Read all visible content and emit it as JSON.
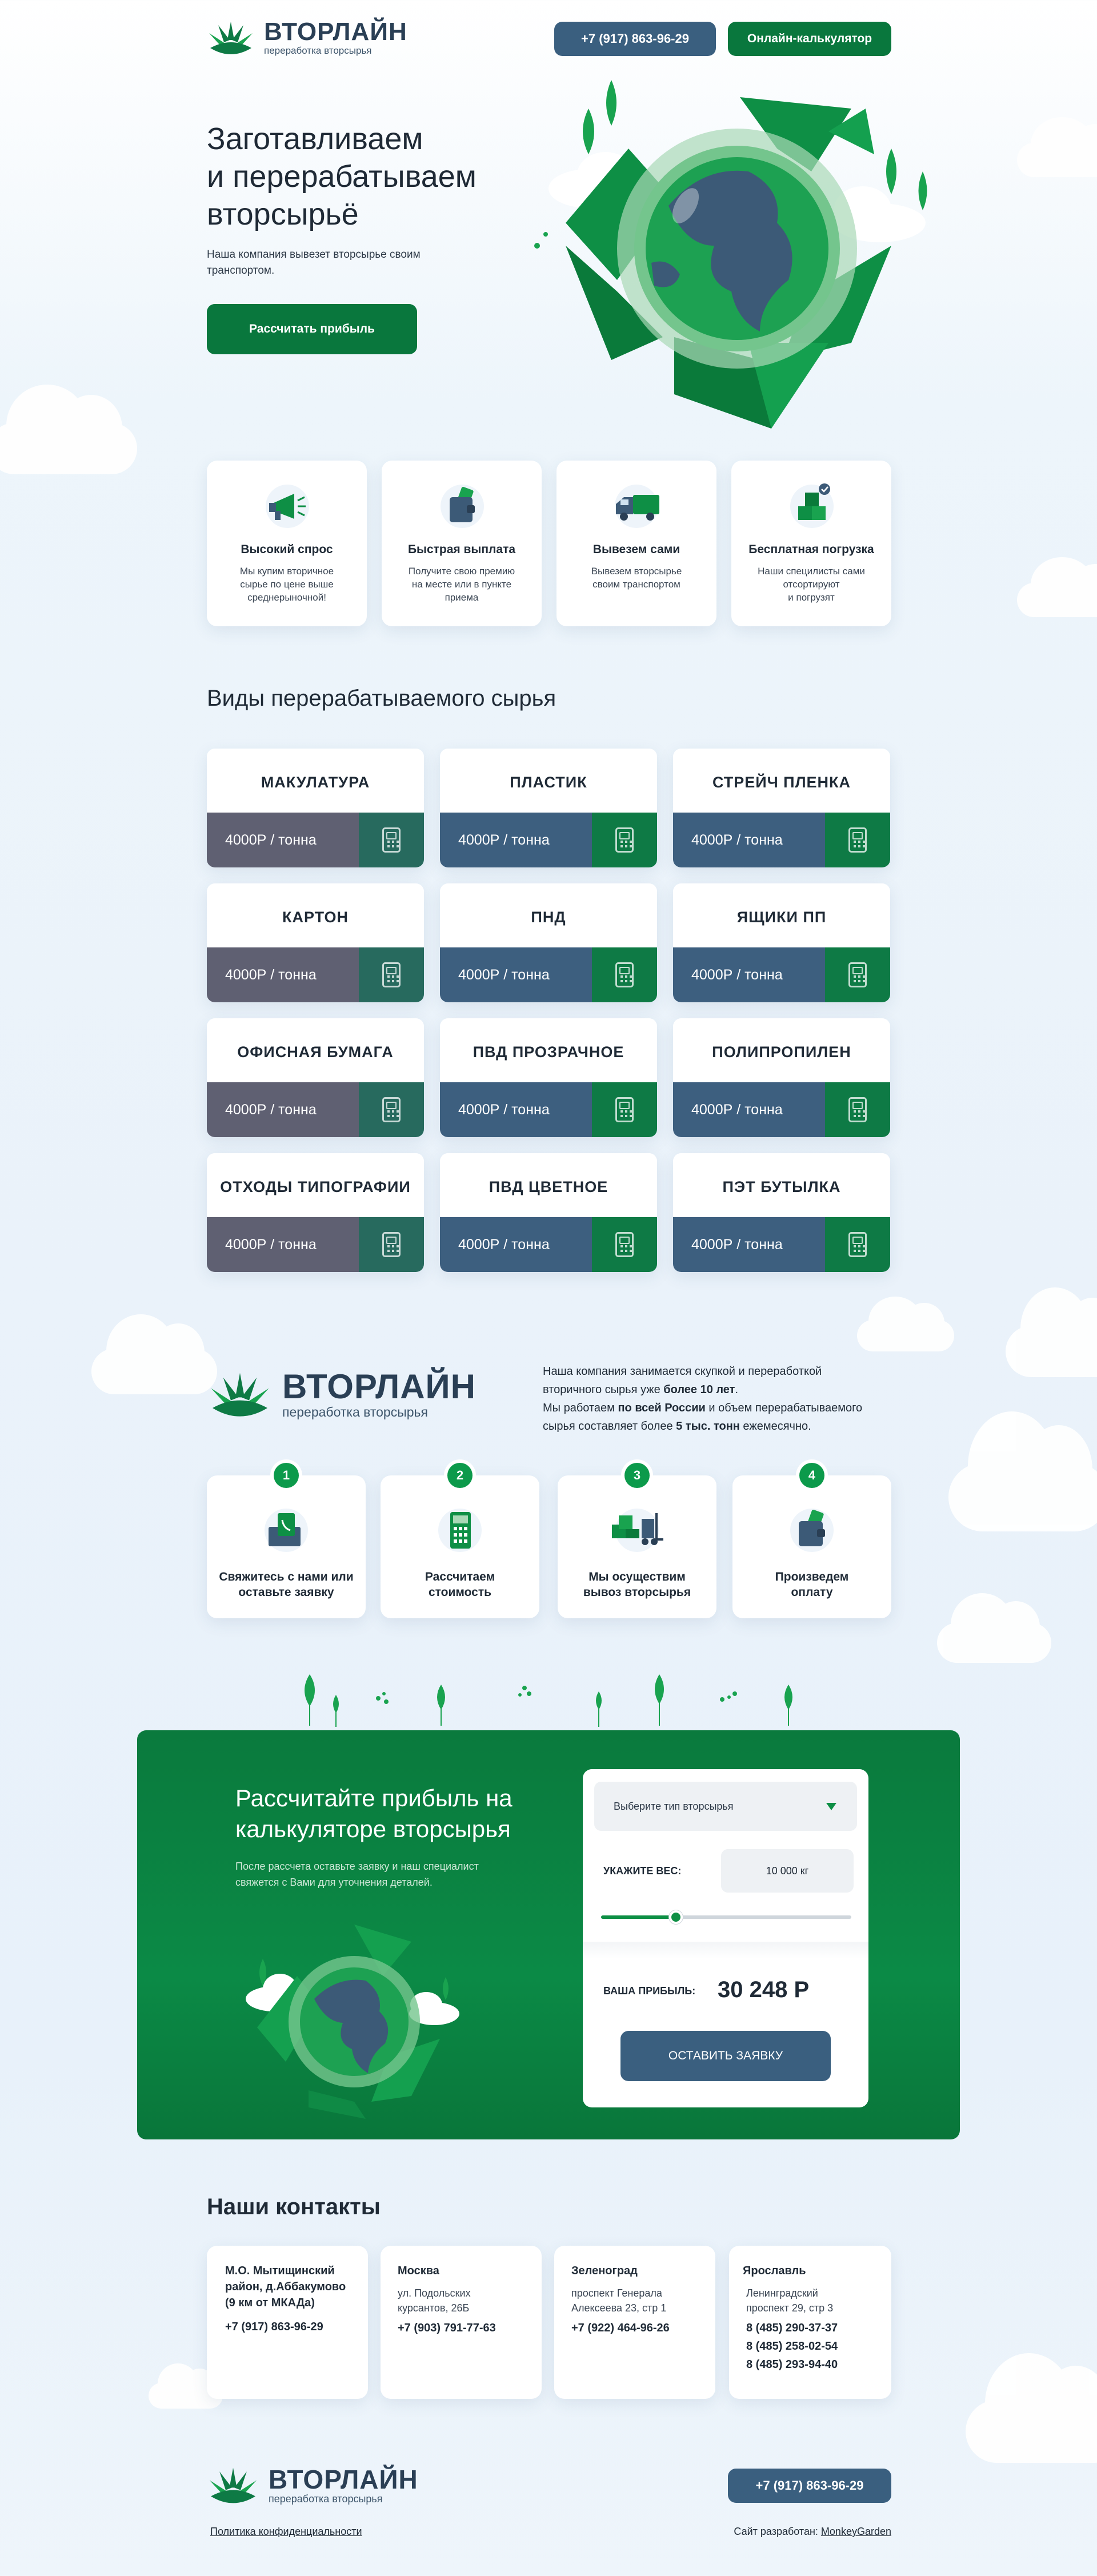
{
  "brand": {
    "name": "ВТОРЛАЙН",
    "tagline": "переработка вторсырья"
  },
  "header": {
    "phone": "+7 (917) 863-96-29",
    "calc_button": "Онлайн-калькулятор"
  },
  "hero": {
    "title_line1": "Заготавливаем",
    "title_line2": "и перерабатываем",
    "title_line3": "вторсырьё",
    "text_line1": "Наша компания вывезет вторсырье своим",
    "text_line2": "транспортом.",
    "button": "Рассчитать прибыль"
  },
  "features": [
    {
      "icon": "megaphone-icon",
      "title": "Высокий спрос",
      "text1": "Мы купим вторичное",
      "text2": "сырье по цене выше",
      "text3": "среднерыночной!"
    },
    {
      "icon": "wallet-icon",
      "title": "Быстрая выплата",
      "text1": "Получите свою премию",
      "text2": "на месте или в пункте",
      "text3": "приема"
    },
    {
      "icon": "truck-icon",
      "title": "Вывезем сами",
      "text1": "Вывезем вторсырье",
      "text2": "своим транспортом",
      "text3": ""
    },
    {
      "icon": "boxes-icon",
      "title": "Бесплатная погрузка",
      "text1": "Наши специлисты сами",
      "text2": "отсортируют",
      "text3": "и погрузят"
    }
  ],
  "materials": {
    "heading": "Виды перерабатываемого сырья",
    "items": [
      {
        "name": "МАКУЛАТУРА",
        "price": "4000Р / тонна"
      },
      {
        "name": "ПЛАСТИК",
        "price": "4000Р / тонна"
      },
      {
        "name": "СТРЕЙЧ ПЛЕНКА",
        "price": "4000Р / тонна"
      },
      {
        "name": "КАРТОН",
        "price": "4000Р / тонна"
      },
      {
        "name": "ПНД",
        "price": "4000Р / тонна"
      },
      {
        "name": "ЯЩИКИ ПП",
        "price": "4000Р / тонна"
      },
      {
        "name": "ОФИСНАЯ БУМАГА",
        "price": "4000Р / тонна"
      },
      {
        "name": "ПВД ПРОЗРАЧНОЕ",
        "price": "4000Р / тонна"
      },
      {
        "name": "ПОЛИПРОПИЛЕН",
        "price": "4000Р / тонна"
      },
      {
        "name": "ОТХОДЫ ТИПОГРАФИИ",
        "price": "4000Р / тонна"
      },
      {
        "name": "ПВД ЦВЕТНОЕ",
        "price": "4000Р / тонна"
      },
      {
        "name": "ПЭТ БУТЫЛКА",
        "price": "4000Р / тонна"
      }
    ],
    "colors": {
      "col1": "#5f6072",
      "col2": "#3d5f7f",
      "col3": "#3d5f7f",
      "calc1": "#276a5e",
      "calc2": "#0e7a45",
      "calc3": "#0e7a45"
    }
  },
  "about": {
    "line1": "Наша компания занимается скупкой и переработкой",
    "line2_a": "вторичного сырья уже ",
    "line2_b": "более 10 лет",
    "line2_c": ".",
    "line3_a": "Мы работаем ",
    "line3_b": "по всей России",
    "line3_c": " и объем перерабатываемого",
    "line4_a": "сырья составляет более ",
    "line4_b": "5 тыс. тонн",
    "line4_c": " ежемесячно."
  },
  "steps": [
    {
      "num": "1",
      "icon": "phone-call-icon",
      "line1": "Свяжитесь с нами или",
      "line2": "оставьте заявку"
    },
    {
      "num": "2",
      "icon": "calculator-icon",
      "line1": "Рассчитаем",
      "line2": "стоимость"
    },
    {
      "num": "3",
      "icon": "forklift-icon",
      "line1": "Мы осуществим",
      "line2": "вывоз вторсырья"
    },
    {
      "num": "4",
      "icon": "wallet-icon",
      "line1": "Произведем",
      "line2": "оплату"
    }
  ],
  "calculator": {
    "title_line1": "Рассчитайте прибыль на",
    "title_line2": "калькуляторе вторсырья",
    "text_line1": "После рассчета оставьте заявку и наш специалист",
    "text_line2": "свяжется с Вами для уточнения деталей.",
    "select_placeholder": "Выберите тип вторсырья",
    "weight_label": "УКАЖИТЕ ВЕС:",
    "weight_value": "10 000 кг",
    "slider_level": 0.3,
    "profit_label": "ВАША ПРИБЫЛЬ:",
    "profit_value": "30 248 Р",
    "submit": "ОСТАВИТЬ ЗАЯВКУ"
  },
  "contacts": {
    "heading": "Наши контакты",
    "items": [
      {
        "title1": "М.О. Мытищинский",
        "title2": "район, д.Аббакумово",
        "title3": "(9 км от МКАДа)",
        "addr1": "",
        "addr2": "",
        "phones": [
          "+7 (917) 863-96-29"
        ]
      },
      {
        "title1": "Москва",
        "title2": "",
        "title3": "",
        "addr1": "ул. Подольских",
        "addr2": "курсантов, 26Б",
        "phones": [
          "+7 (903) 791-77-63"
        ]
      },
      {
        "title1": "Зеленоград",
        "title2": "",
        "title3": "",
        "addr1": "проспект Генерала",
        "addr2": "Алексеева 23, стр 1",
        "phones": [
          "+7 (922) 464-96-26"
        ]
      },
      {
        "title1": "Ярославль",
        "title2": "",
        "title3": "",
        "addr1": "Ленинградский",
        "addr2": "проспект 29, стр 3",
        "phones": [
          "8 (485) 290-37-37",
          "8 (485) 258-02-54",
          "8 (485) 293-94-40"
        ]
      }
    ]
  },
  "footer": {
    "phone": "+7 (917) 863-96-29",
    "privacy": "Политика конфиденциальности",
    "dev_label": "Сайт разработан:",
    "dev_name": "MonkeyGarden"
  }
}
